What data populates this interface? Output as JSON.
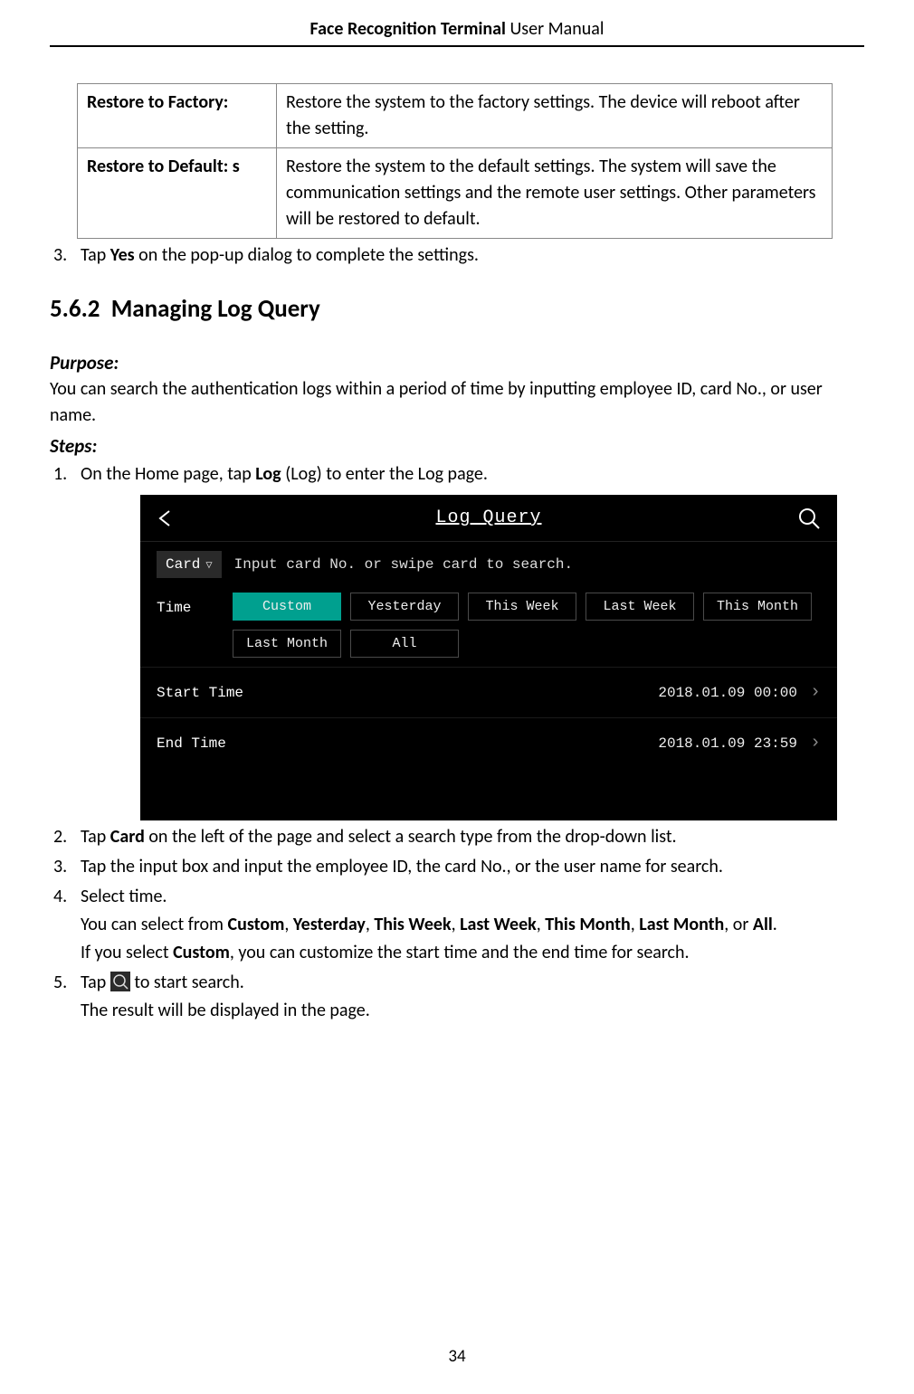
{
  "header": {
    "bold": "Face Recognition Terminal",
    "rest": "  User Manual"
  },
  "table": {
    "rows": [
      {
        "label": "Restore to Factory:",
        "desc": "Restore the system to the factory settings. The device will reboot after the setting."
      },
      {
        "label": "Restore to Default: s",
        "desc": "Restore the system to the default settings. The system will save the communication settings and the remote user settings. Other parameters will be restored to default."
      }
    ]
  },
  "step3_pre": "Tap ",
  "step3_b": "Yes",
  "step3_post": " on the pop-up dialog to complete the settings.",
  "section_num": "5.6.2",
  "section_title": "Managing Log Query",
  "purpose_label": "Purpose:",
  "purpose_text": "You can search the authentication logs within a period of time by inputting employee ID, card No., or user name.",
  "steps_label": "Steps:",
  "step1_pre": "On the Home page, tap ",
  "step1_b": "Log",
  "step1_post": " (Log) to enter the Log page.",
  "screenshot": {
    "title": "Log Query",
    "card_label": "Card",
    "placeholder": "Input card No. or swipe card to search.",
    "time_label": "Time",
    "chips": [
      "Custom",
      "Yesterday",
      "This Week",
      "Last Week",
      "This Month",
      "Last Month",
      "All"
    ],
    "active_chip_index": 0,
    "start_label": "Start Time",
    "start_val": "2018.01.09  00:00",
    "end_label": "End Time",
    "end_val": "2018.01.09  23:59"
  },
  "step2_pre": "Tap ",
  "step2_b": "Card",
  "step2_post": " on the left of the page and select a search type from the drop-down list.",
  "step3b": "Tap the input box and input the employee ID, the card No., or the user name for search.",
  "step4": "Select time.",
  "step4_sub1_pre": "You can select from ",
  "step4_opts": [
    "Custom",
    "Yesterday",
    "This Week",
    "Last Week",
    "This Month",
    "Last Month"
  ],
  "step4_sub1_or": ", or ",
  "step4_sub1_all": "All",
  "step4_sub1_end": ".",
  "step4_sub2_pre": "If you select ",
  "step4_sub2_b": "Custom",
  "step4_sub2_post": ", you can customize the start time and the end time for search.",
  "step5_pre": "Tap ",
  "step5_post": " to start search.",
  "step5_sub": "The result will be displayed in the page.",
  "page_number": "34"
}
